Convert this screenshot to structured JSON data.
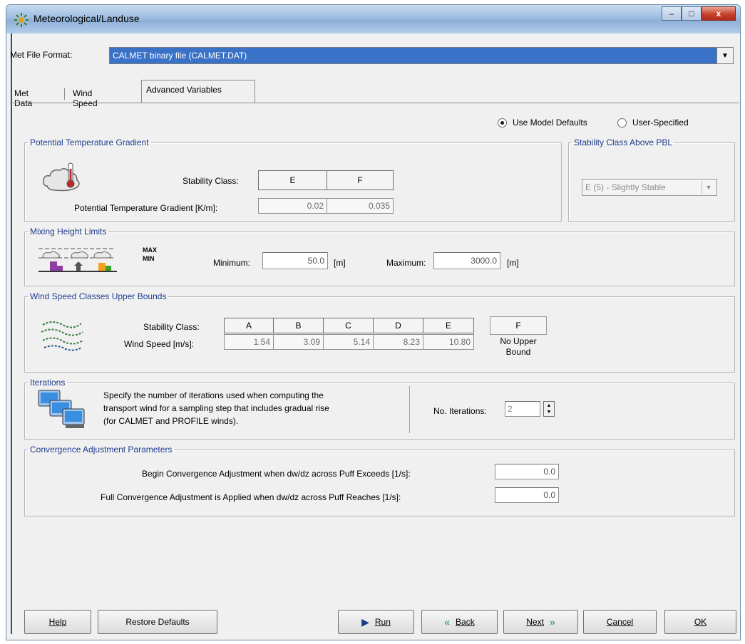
{
  "window": {
    "title": "Meteorological/Landuse",
    "minimize": "–",
    "maximize": "□",
    "close": "x"
  },
  "met_file": {
    "label": "Met File Format:",
    "value": "CALMET binary file (CALMET.DAT)",
    "arrow": "▼"
  },
  "tabs": [
    {
      "label": "Met Data",
      "active": false
    },
    {
      "label": "Wind Speed",
      "active": false
    },
    {
      "label": "Advanced Variables",
      "active": true
    }
  ],
  "defaults": {
    "use_defaults": "Use Model Defaults",
    "user_specified": "User-Specified",
    "selected": "Use Model Defaults"
  },
  "ptg": {
    "title": "Potential Temperature Gradient",
    "stability_label": "Stability Class:",
    "gradient_label": "Potential Temperature Gradient [K/m]:",
    "classes": [
      "E",
      "F"
    ],
    "values": [
      "0.02",
      "0.035"
    ]
  },
  "pbl": {
    "title": "Stability Class Above PBL",
    "value": "E (5) - Slightly Stable",
    "arrow": "▼"
  },
  "mixing": {
    "title": "Mixing Height Limits",
    "icon_max": "MAX",
    "icon_min": "MIN",
    "min_label": "Minimum:",
    "min_value": "50.0",
    "min_unit": "[m]",
    "max_label": "Maximum:",
    "max_value": "3000.0",
    "max_unit": "[m]"
  },
  "wind": {
    "title": "Wind Speed Classes Upper Bounds",
    "stability_label": "Stability Class:",
    "speed_label": "Wind Speed [m/s]:",
    "classes": [
      "A",
      "B",
      "C",
      "D",
      "E"
    ],
    "values": [
      "1.54",
      "3.09",
      "5.14",
      "8.23",
      "10.80"
    ],
    "last_class": "F",
    "last_text": "No Upper Bound"
  },
  "iterations": {
    "title": "Iterations",
    "line1": "Specify the number of iterations used when computing the",
    "line2": "transport wind for a sampling step that includes gradual rise",
    "line3": "(for CALMET and PROFILE winds).",
    "label": "No. Iterations:",
    "value": "2",
    "spin_up": "▲",
    "spin_down": "▼"
  },
  "convergence": {
    "title": "Convergence Adjustment Parameters",
    "begin_label": "Begin Convergence Adjustment when dw/dz across Puff Exceeds [1/s]:",
    "begin_value": "0.0",
    "full_label": "Full Convergence Adjustment is Applied when dw/dz across Puff Reaches [1/s]:",
    "full_value": "0.0"
  },
  "buttons": {
    "help": "Help",
    "restore": "Restore Defaults",
    "run": "Run",
    "back": "Back",
    "next": "Next",
    "cancel": "Cancel",
    "ok": "OK"
  },
  "icons": {
    "app": "weather-app-icon",
    "thermometer": "thermometer-cloud-icon",
    "mixing": "mixing-height-icon",
    "wind": "wind-icon",
    "computers": "computers-icon",
    "run": "play-icon",
    "back": "back-chevrons-icon",
    "next": "next-chevrons-icon"
  },
  "colors": {
    "selection": "#3a72c8",
    "group_label": "#1a3a8a"
  }
}
